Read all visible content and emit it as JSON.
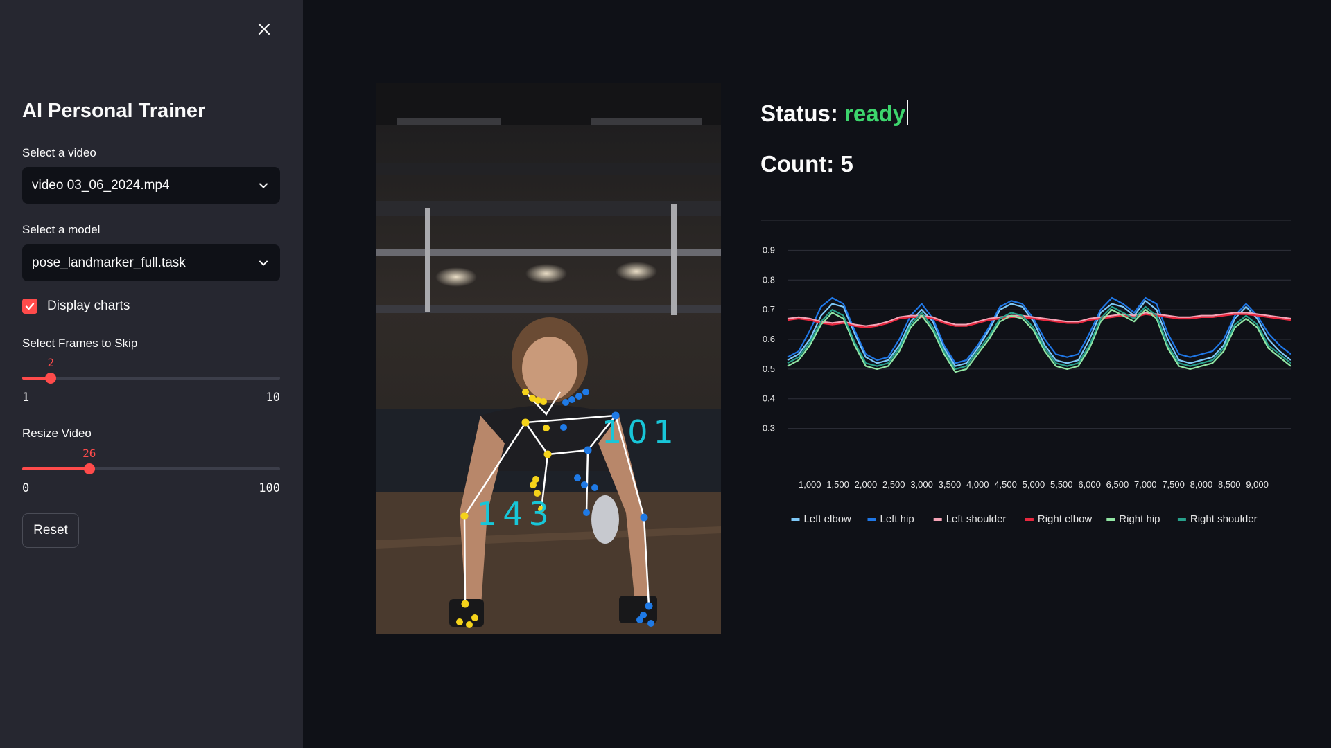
{
  "sidebar": {
    "title": "AI Personal Trainer",
    "video_label": "Select a video",
    "video_value": "video 03_06_2024.mp4",
    "model_label": "Select a model",
    "model_value": "pose_landmarker_full.task",
    "display_charts_label": "Display charts",
    "display_charts_checked": true,
    "frames_skip": {
      "label": "Select Frames to Skip",
      "value": 2,
      "min": 1,
      "max": 10,
      "value_text": "2",
      "min_text": "1",
      "max_text": "10"
    },
    "resize": {
      "label": "Resize Video",
      "value": 26,
      "min": 0,
      "max": 100,
      "value_text": "26",
      "min_text": "0",
      "max_text": "100"
    },
    "reset_label": "Reset"
  },
  "video": {
    "angle_left": "143",
    "angle_right": "101"
  },
  "main": {
    "status_label": "Status:",
    "status_value": "ready",
    "count_label": "Count:",
    "count_value": "5"
  },
  "colors": {
    "accent": "#ff4b4b",
    "status_ready": "#3dd56d",
    "sidebar_bg": "#262730",
    "main_bg": "#0f1117",
    "angle_text": "#18c6d8"
  },
  "icons": {
    "close": "close-icon",
    "dropdown": "chevron-down-icon",
    "check": "check-icon"
  },
  "chart_data": {
    "type": "line",
    "xlim": [
      600,
      9600
    ],
    "ylim": [
      0.25,
      0.95
    ],
    "yticks": [
      0.3,
      0.4,
      0.5,
      0.6,
      0.7,
      0.8,
      0.9
    ],
    "ytick_labels": [
      "0.3",
      "0.4",
      "0.5",
      "0.6",
      "0.7",
      "0.8",
      "0.9"
    ],
    "xticks": [
      1000,
      1500,
      2000,
      2500,
      3000,
      3500,
      4000,
      4500,
      5000,
      5500,
      6000,
      6500,
      7000,
      7500,
      8000,
      8500,
      9000
    ],
    "xtick_labels": [
      "1,000",
      "1,500",
      "2,000",
      "2,500",
      "3,000",
      "3,500",
      "4,000",
      "4,500",
      "5,000",
      "5,500",
      "6,000",
      "6,500",
      "7,000",
      "7,500",
      "8,000",
      "8,500",
      "9,000"
    ],
    "grid": true,
    "legend_position": "bottom",
    "x": [
      600,
      800,
      1000,
      1200,
      1400,
      1600,
      1800,
      2000,
      2200,
      2400,
      2600,
      2800,
      3000,
      3200,
      3400,
      3600,
      3800,
      4000,
      4200,
      4400,
      4600,
      4800,
      5000,
      5200,
      5400,
      5600,
      5800,
      6000,
      6200,
      6400,
      6600,
      6800,
      7000,
      7200,
      7400,
      7600,
      7800,
      8000,
      8200,
      8400,
      8600,
      8800,
      9000,
      9200,
      9400,
      9600
    ],
    "series": [
      {
        "name": "Left elbow",
        "color": "#7ec8f7",
        "values": [
          0.53,
          0.55,
          0.6,
          0.68,
          0.72,
          0.71,
          0.62,
          0.54,
          0.52,
          0.53,
          0.58,
          0.66,
          0.7,
          0.66,
          0.57,
          0.51,
          0.52,
          0.57,
          0.63,
          0.7,
          0.72,
          0.71,
          0.66,
          0.58,
          0.53,
          0.52,
          0.53,
          0.6,
          0.69,
          0.72,
          0.71,
          0.68,
          0.73,
          0.7,
          0.6,
          0.53,
          0.52,
          0.53,
          0.54,
          0.58,
          0.67,
          0.71,
          0.67,
          0.6,
          0.56,
          0.53
        ]
      },
      {
        "name": "Left hip",
        "color": "#1f77e6",
        "values": [
          0.54,
          0.56,
          0.63,
          0.71,
          0.74,
          0.72,
          0.63,
          0.55,
          0.53,
          0.54,
          0.6,
          0.68,
          0.72,
          0.67,
          0.58,
          0.52,
          0.53,
          0.58,
          0.64,
          0.71,
          0.73,
          0.72,
          0.67,
          0.6,
          0.55,
          0.54,
          0.55,
          0.62,
          0.7,
          0.74,
          0.72,
          0.69,
          0.74,
          0.72,
          0.62,
          0.55,
          0.54,
          0.55,
          0.56,
          0.6,
          0.68,
          0.72,
          0.68,
          0.62,
          0.58,
          0.55
        ]
      },
      {
        "name": "Left shoulder",
        "color": "#f5a3b6",
        "values": [
          0.67,
          0.675,
          0.67,
          0.66,
          0.655,
          0.66,
          0.65,
          0.645,
          0.65,
          0.66,
          0.675,
          0.68,
          0.68,
          0.675,
          0.66,
          0.65,
          0.65,
          0.66,
          0.67,
          0.675,
          0.68,
          0.68,
          0.675,
          0.67,
          0.665,
          0.66,
          0.66,
          0.67,
          0.675,
          0.68,
          0.685,
          0.68,
          0.69,
          0.685,
          0.68,
          0.675,
          0.675,
          0.68,
          0.68,
          0.685,
          0.69,
          0.69,
          0.685,
          0.68,
          0.675,
          0.67
        ]
      },
      {
        "name": "Right elbow",
        "color": "#e8283f",
        "values": [
          0.665,
          0.67,
          0.665,
          0.655,
          0.65,
          0.655,
          0.645,
          0.64,
          0.645,
          0.655,
          0.67,
          0.675,
          0.675,
          0.67,
          0.655,
          0.645,
          0.645,
          0.655,
          0.665,
          0.67,
          0.675,
          0.675,
          0.67,
          0.665,
          0.66,
          0.655,
          0.655,
          0.665,
          0.67,
          0.675,
          0.68,
          0.675,
          0.685,
          0.68,
          0.675,
          0.67,
          0.67,
          0.675,
          0.675,
          0.68,
          0.685,
          0.685,
          0.68,
          0.675,
          0.67,
          0.665
        ]
      },
      {
        "name": "Right hip",
        "color": "#92e6a4",
        "values": [
          0.51,
          0.53,
          0.58,
          0.65,
          0.69,
          0.67,
          0.58,
          0.51,
          0.5,
          0.51,
          0.56,
          0.64,
          0.68,
          0.63,
          0.55,
          0.49,
          0.5,
          0.55,
          0.6,
          0.66,
          0.68,
          0.67,
          0.63,
          0.56,
          0.51,
          0.5,
          0.51,
          0.57,
          0.66,
          0.7,
          0.68,
          0.66,
          0.7,
          0.67,
          0.57,
          0.51,
          0.5,
          0.51,
          0.52,
          0.56,
          0.64,
          0.67,
          0.64,
          0.57,
          0.54,
          0.51
        ]
      },
      {
        "name": "Right shoulder",
        "color": "#27a08b",
        "values": [
          0.52,
          0.54,
          0.59,
          0.66,
          0.7,
          0.68,
          0.59,
          0.52,
          0.51,
          0.52,
          0.57,
          0.65,
          0.69,
          0.64,
          0.56,
          0.5,
          0.51,
          0.56,
          0.61,
          0.67,
          0.69,
          0.68,
          0.64,
          0.57,
          0.52,
          0.51,
          0.52,
          0.58,
          0.67,
          0.71,
          0.69,
          0.67,
          0.71,
          0.68,
          0.58,
          0.52,
          0.51,
          0.52,
          0.53,
          0.57,
          0.65,
          0.68,
          0.65,
          0.58,
          0.55,
          0.52
        ]
      }
    ]
  }
}
